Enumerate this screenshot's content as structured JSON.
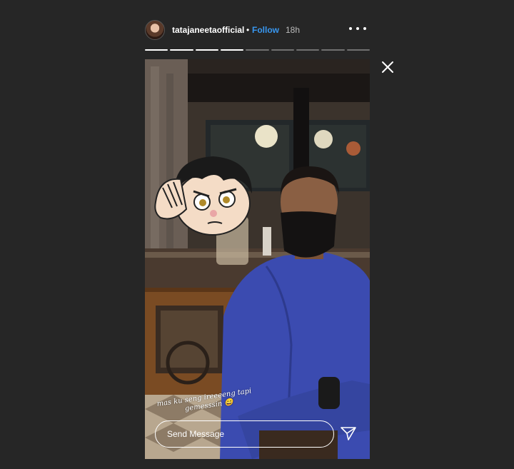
{
  "header": {
    "username": "tatajaneetaofficial",
    "separator": "•",
    "follow_label": "Follow",
    "time": "18h",
    "more_icon": "more-horizontal-icon"
  },
  "progress": {
    "total_segments": 9,
    "completed_segments": 4
  },
  "story": {
    "caption_line1": "mas ku seng ireeeeng tapi",
    "caption_line2": "gemesssin 😄",
    "sticker": "cartoon-boy-sticker"
  },
  "reply": {
    "placeholder": "Send Message",
    "send_icon": "paper-plane-icon"
  },
  "colors": {
    "background": "#262626",
    "follow": "#3897f0"
  }
}
